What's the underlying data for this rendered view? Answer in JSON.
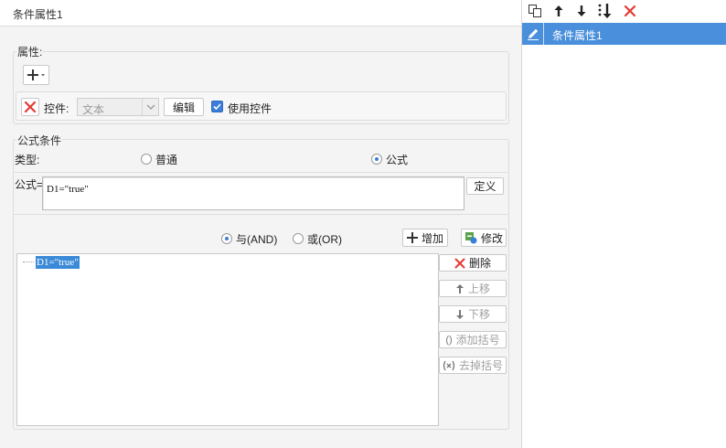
{
  "header": {
    "title": "条件属性1"
  },
  "attributes": {
    "legend": "属性:",
    "add_icon": "plus-dropdown-icon",
    "control_label": "控件:",
    "control_value": "文本",
    "edit_button": "编辑",
    "use_control_label": "使用控件",
    "use_control_checked": true
  },
  "formula_condition": {
    "legend": "公式条件",
    "type_label": "类型:",
    "type_options": [
      "普通",
      "公式"
    ],
    "type_selected": "公式",
    "formula_label": "公式=",
    "formula_value": "D1=\"true\"",
    "define_button": "定义",
    "and_label": "与(AND)",
    "or_label": "或(OR)",
    "logic_selected": "与(AND)",
    "add_button": "增加",
    "modify_button": "修改",
    "conditions": [
      "D1=\"true\""
    ],
    "delete_button": "删除",
    "move_up_button": "上移",
    "move_down_button": "下移",
    "add_bracket_button": "添加括号",
    "remove_bracket_button": "去掉括号"
  },
  "right_panel": {
    "toolbar_icons": [
      "copy-icon",
      "arrow-up-icon",
      "arrow-down-icon",
      "move-bottom-icon",
      "delete-icon"
    ],
    "items": [
      {
        "label": "条件属性1",
        "selected": true
      }
    ]
  },
  "colors": {
    "accent": "#3b8ad8",
    "delete_red": "#e53935",
    "selection": "#4a8fdc"
  }
}
